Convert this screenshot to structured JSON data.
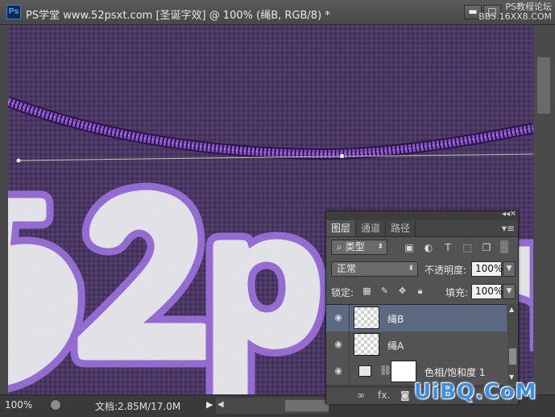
{
  "window": {
    "app_logo": "Ps",
    "title": "PS学堂 www.52psxt.com [圣诞字效] @ 100% (绳B, RGB/8) *",
    "buttons": {
      "minimize": "▬",
      "restore": "□"
    },
    "watermark_top": [
      "PS教程论坛",
      "BBS.16XX8.COM"
    ]
  },
  "canvas": {
    "artwork_letters": [
      "5",
      "2",
      "p",
      "s"
    ],
    "background_color": "#4a3863",
    "letter_color": "#e9e9ee",
    "rope_color": "#8a4fd6"
  },
  "status_bar": {
    "zoom": "100%",
    "doc_info": "文档:2.85M/17.0M",
    "arrow": "▶",
    "scroll_left": "◀"
  },
  "layers_panel": {
    "collapse": "◂◂",
    "close": "✕",
    "tabs": [
      {
        "label": "图层",
        "active": true
      },
      {
        "label": "通道",
        "active": false
      },
      {
        "label": "路径",
        "active": false
      }
    ],
    "menu_icon": "▾≡",
    "filter": {
      "search_icon": "⌕",
      "kind": "类型",
      "filter_icons": [
        "image-filter-icon",
        "adjustment-filter-icon",
        "type-filter-icon",
        "shape-filter-icon",
        "smart-object-filter-icon"
      ]
    },
    "blend_mode": "正常",
    "opacity_label": "不透明度:",
    "opacity_value": "100%",
    "lock_label": "锁定:",
    "fill_label": "填充:",
    "fill_value": "100%",
    "layers": [
      {
        "name": "绳B",
        "selected": true,
        "visible": true
      },
      {
        "name": "绳A",
        "selected": false,
        "visible": true
      },
      {
        "name": "色相/饱和度 1",
        "selected": false,
        "visible": true,
        "type": "adjustment"
      }
    ],
    "footer_icons": [
      "link-icon",
      "fx-icon",
      "add-mask-icon"
    ],
    "footer_fx": "fx."
  },
  "watermark_bottom": "UiBQ.CoM"
}
